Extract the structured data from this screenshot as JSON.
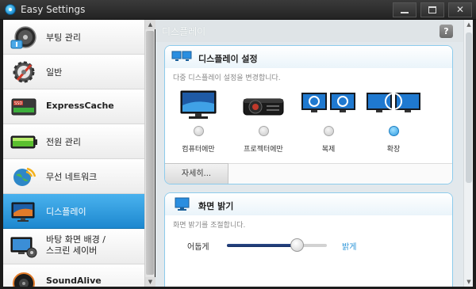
{
  "window": {
    "title": "Easy Settings",
    "controls": {
      "minimize": "",
      "maximize": "",
      "close": "✕"
    }
  },
  "sidebar": {
    "items": [
      {
        "label": "부팅 관리",
        "icon": "disk-gauge-icon",
        "active": false
      },
      {
        "label": "일반",
        "icon": "gear-wrench-icon",
        "active": false
      },
      {
        "label": "ExpressCache",
        "icon": "ssd-icon",
        "active": false
      },
      {
        "label": "전원 관리",
        "icon": "battery-icon",
        "active": false
      },
      {
        "label": "무선 네트워크",
        "icon": "wifi-globe-icon",
        "active": false
      },
      {
        "label": "디스플레이",
        "icon": "monitor-icon",
        "active": true
      },
      {
        "label_line1": "바탕 화면 배경 /",
        "label_line2": "스크린 세이버",
        "icon": "desktop-film-icon",
        "active": false
      },
      {
        "label": "SoundAlive",
        "icon": "speaker-icon",
        "active": false
      }
    ]
  },
  "main": {
    "title": "디스플레이",
    "help": "?",
    "display_settings": {
      "title": "디스플레이 설정",
      "description": "다중 디스플레이 설정을 변경합니다.",
      "options": [
        {
          "label": "컴퓨터에만",
          "icon": "single-monitor-icon",
          "selected": false
        },
        {
          "label": "프로젝터에만",
          "icon": "projector-icon",
          "selected": false
        },
        {
          "label": "복제",
          "icon": "duplicate-monitors-icon",
          "selected": false
        },
        {
          "label": "확장",
          "icon": "extend-monitors-icon",
          "selected": true
        }
      ],
      "detail_button": "자세히..."
    },
    "brightness": {
      "title": "화면 밝기",
      "description": "화면 밝기를 조절합니다.",
      "dark_label": "어둡게",
      "bright_label": "밝게",
      "level_percent": 70
    }
  },
  "colors": {
    "accent": "#1d88cf",
    "card_border": "#8ccbec",
    "bright_label": "#2a94d8"
  }
}
